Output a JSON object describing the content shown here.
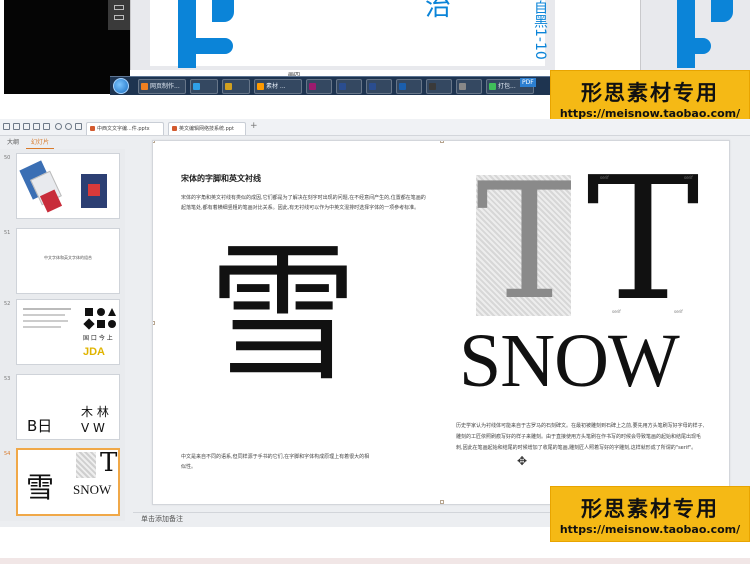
{
  "top_screenshot": {
    "blue_char_top": "治",
    "blue_vertical_text": "自黑1-10",
    "ruler_label": "画四",
    "taskbar": {
      "buttons": [
        {
          "label": "网页制作...",
          "icon_color": "#f08020"
        },
        {
          "label": "",
          "icon_color": "#2fa0e8"
        },
        {
          "label": "",
          "icon_color": "#d0a020"
        },
        {
          "label": "素材 ...",
          "icon_color": "#ff9a00"
        },
        {
          "label": "",
          "icon_color": "#9b1b6e"
        },
        {
          "label": "",
          "icon_color": "#2a4d8f"
        },
        {
          "label": "",
          "icon_color": "#2a4d8f"
        },
        {
          "label": "",
          "icon_color": "#1b5fae"
        },
        {
          "label": "",
          "icon_color": "#3a3a3a"
        },
        {
          "label": "",
          "icon_color": "#888888"
        },
        {
          "label": "打包...",
          "icon_color": "#3fbf5a"
        }
      ],
      "pdf_label": "PDF"
    }
  },
  "watermark": {
    "title": "形思素材专用",
    "url": "https://meisnow.taobao.com/"
  },
  "app": {
    "tabs": [
      {
        "label": "中西文文字编...件.pptx"
      },
      {
        "label": "英文编辑网络技系统.ppt"
      }
    ],
    "add_tab": "+",
    "pane_tabs": {
      "outline": "大纲",
      "slides": "幻灯片"
    },
    "thumbnails": [
      {
        "number": "50",
        "caption": ""
      },
      {
        "number": "51",
        "caption": "中文字体和英文字体的组合"
      },
      {
        "number": "52",
        "caption": ""
      },
      {
        "number": "53",
        "caption": ""
      },
      {
        "number": "54",
        "caption": ""
      }
    ],
    "thumb52_text": "国 口 今 上",
    "thumb52_brand": "JDA",
    "thumb53": {
      "left": "B日",
      "right_top": "木 林",
      "right_bottom": "V W"
    },
    "thumb54": {
      "char": "雪",
      "letter": "T",
      "word": "SNOW"
    },
    "notes_placeholder": "单击添加备注"
  },
  "slide": {
    "heading": "宋体的字脚和英文衬线",
    "body": "宋体的字角和英文衬线有类似的成因,它们都是为了解决在刻字时出现的问题,在不经意间产生的,位置都在笔画的起落笔处,都有着横细竖粗的笔画对比关系。因此,有无衬线可以作为中英文混排时选择字体的一项参考标准。",
    "big_char": "雪",
    "caption_left": "中文是来自不同的语系,但同样源于手书的它们,在字脚和字体构成原理上有着很大的相似性。",
    "t_letter": "T",
    "serif_labels": [
      "serif",
      "serif",
      "serif",
      "serif"
    ],
    "snow": "SNOW",
    "caption_right": "历史学家认为衬线体可能来自于古罗马的石刻碑文。在最初被雕刻到石碑上之前,要先用方头笔刷写好字母的样子,雕刻的工匠依照刷痕写好的样子来雕刻。由于直接使用方头笔刷在作书写的时候会导致笔画的起始和结尾出现毛刺,因此在笔画起始和结尾的时候增加了收尾的笔画,雕刻匠人照着写好的字雕刻,这样就形成了所谓的\"serif\"。"
  }
}
